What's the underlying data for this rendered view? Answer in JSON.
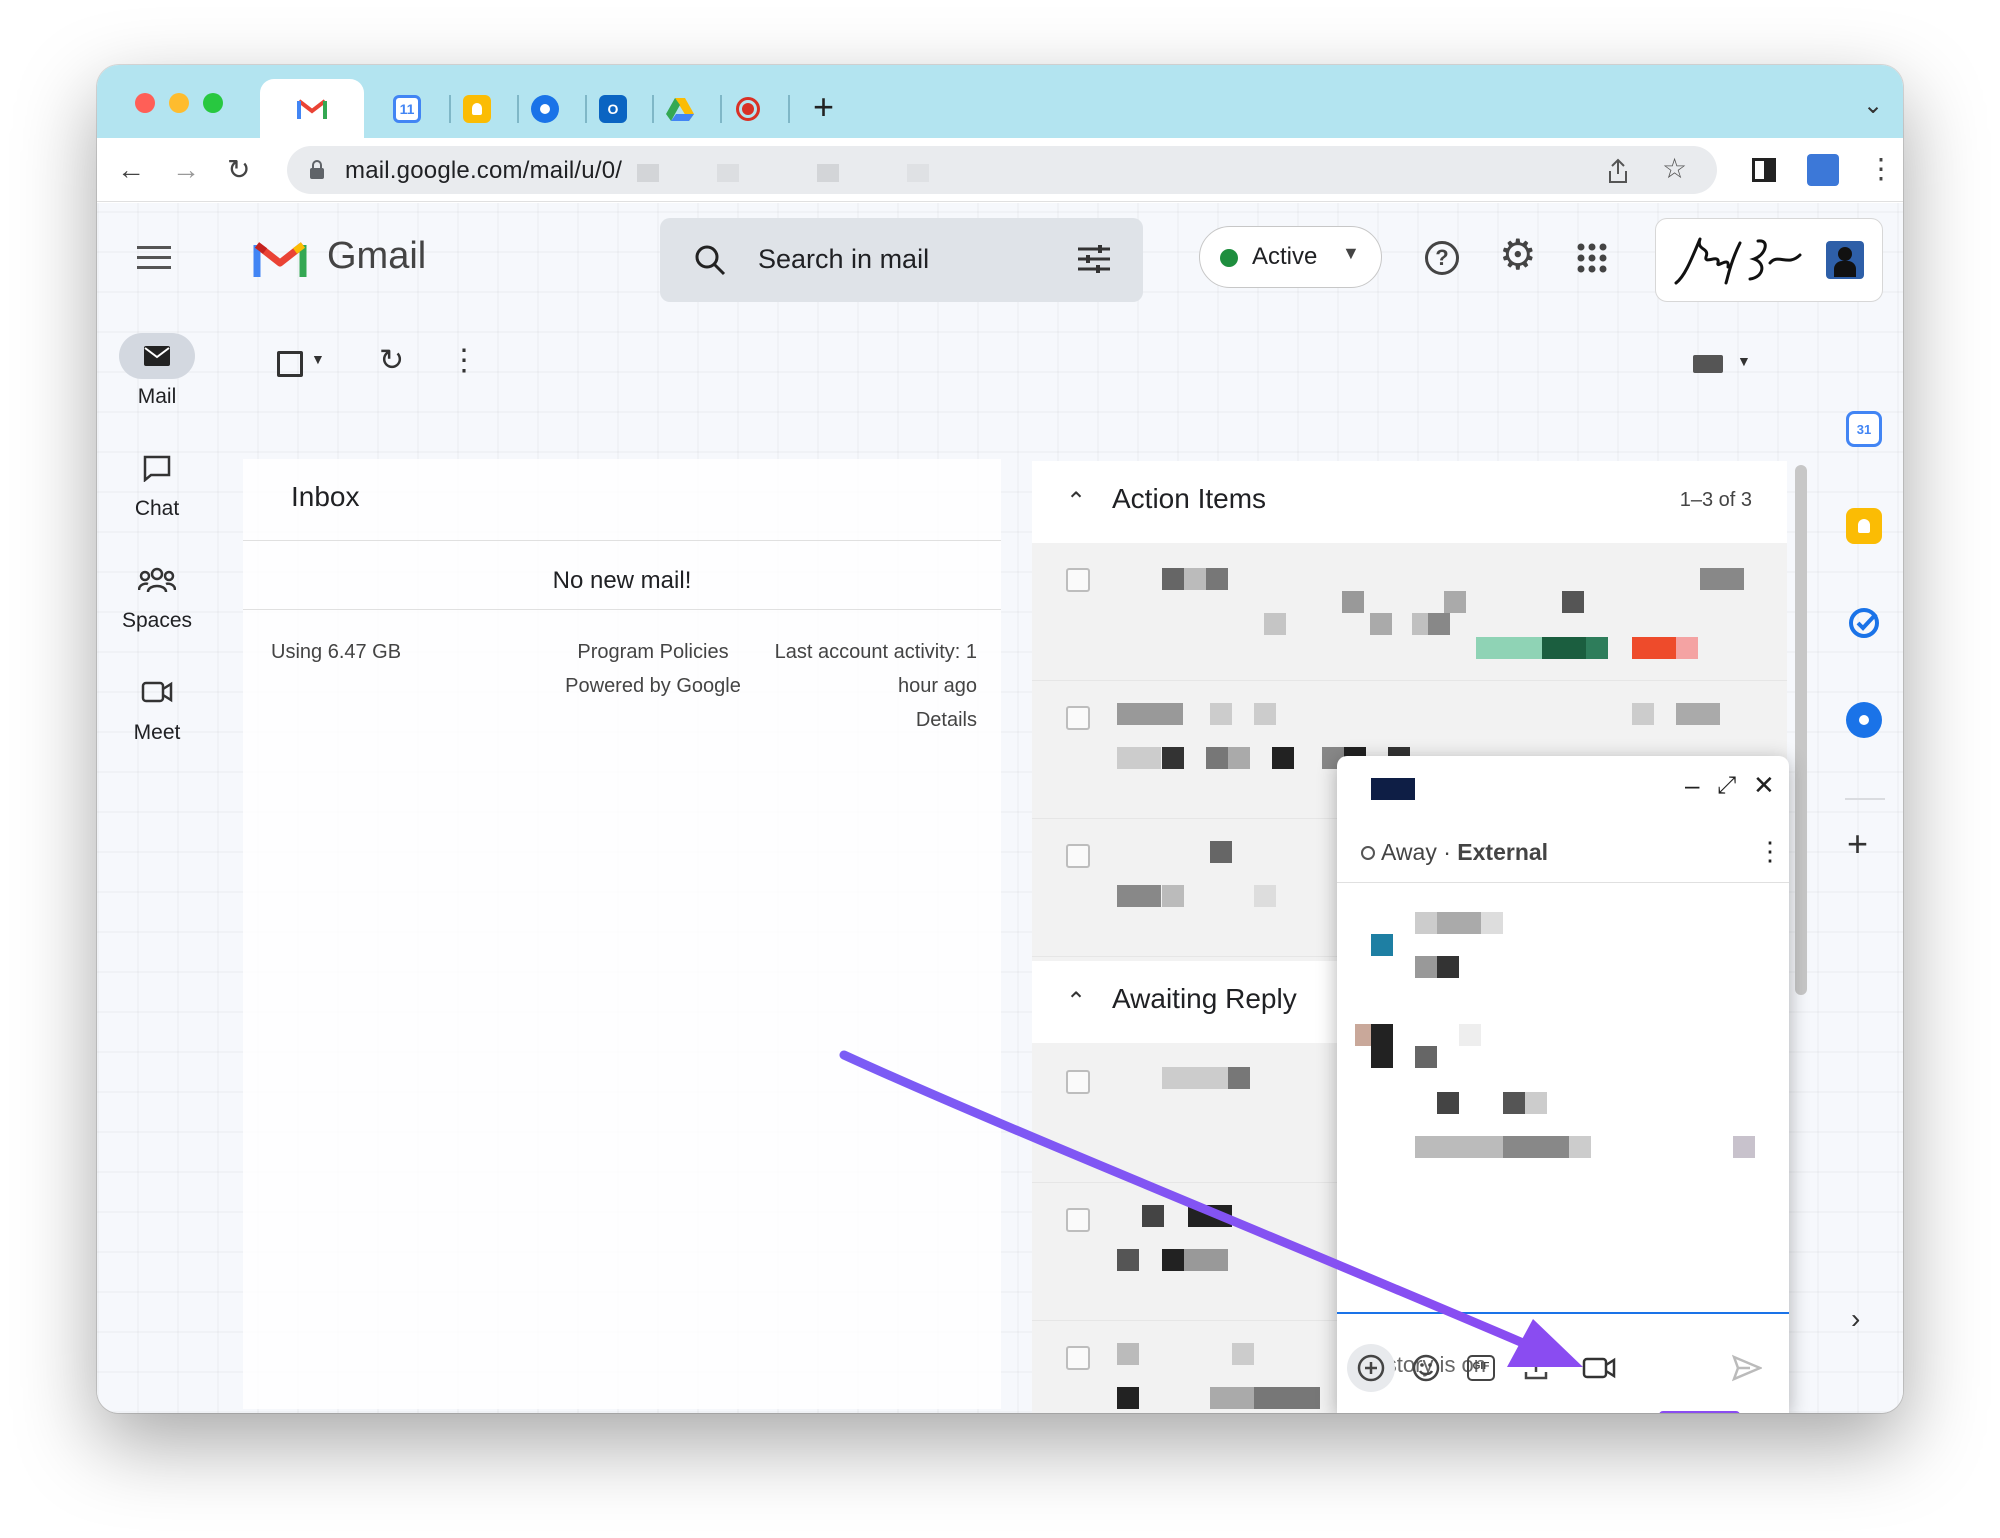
{
  "browser": {
    "url": "mail.google.com/mail/u/0/",
    "tabs": [
      {
        "icon": "gmail-icon",
        "active": true
      },
      {
        "icon": "calendar-icon",
        "label": "11"
      },
      {
        "icon": "keep-icon"
      },
      {
        "icon": "contacts-icon"
      },
      {
        "icon": "outlook-icon"
      },
      {
        "icon": "drive-icon"
      },
      {
        "icon": "record-icon"
      }
    ]
  },
  "gmail": {
    "app_name": "Gmail",
    "search_placeholder": "Search in mail",
    "status_label": "Active",
    "status_color": "#1e8e3e",
    "nav": [
      {
        "label": "Mail",
        "icon": "mail-icon"
      },
      {
        "label": "Chat",
        "icon": "chat-icon"
      },
      {
        "label": "Spaces",
        "icon": "spaces-icon"
      },
      {
        "label": "Meet",
        "icon": "meet-icon"
      }
    ],
    "inbox": {
      "title": "Inbox",
      "empty_message": "No new mail!",
      "storage": "Using 6.47 GB",
      "program_policies": "Program Policies",
      "powered_by": "Powered by Google",
      "last_activity_line1": "Last account activity: 1",
      "last_activity_line2": "hour ago",
      "details": "Details"
    },
    "action_items": {
      "title": "Action Items",
      "count": "1–3 of 3"
    },
    "awaiting_reply": {
      "title": "Awaiting Reply"
    }
  },
  "chat_window": {
    "presence": "Away",
    "separator": "·",
    "external": "External",
    "history": "History is on",
    "highlight_color": "#8a4cf1"
  }
}
